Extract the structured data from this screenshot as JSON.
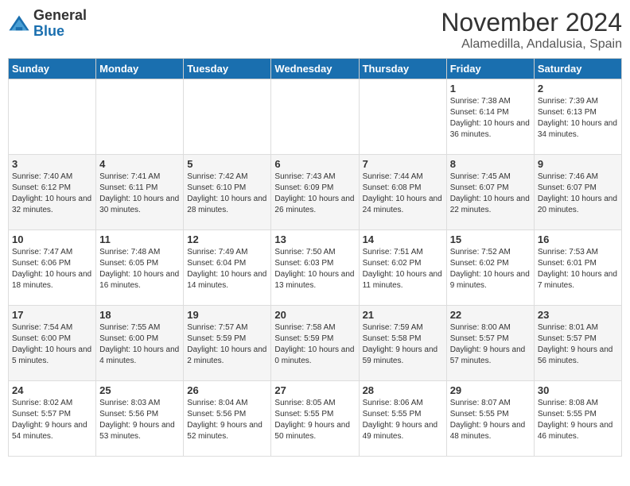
{
  "header": {
    "logo_general": "General",
    "logo_blue": "Blue",
    "month_title": "November 2024",
    "location": "Alamedilla, Andalusia, Spain"
  },
  "weekdays": [
    "Sunday",
    "Monday",
    "Tuesday",
    "Wednesday",
    "Thursday",
    "Friday",
    "Saturday"
  ],
  "weeks": [
    [
      {
        "day": "",
        "info": ""
      },
      {
        "day": "",
        "info": ""
      },
      {
        "day": "",
        "info": ""
      },
      {
        "day": "",
        "info": ""
      },
      {
        "day": "",
        "info": ""
      },
      {
        "day": "1",
        "info": "Sunrise: 7:38 AM\nSunset: 6:14 PM\nDaylight: 10 hours and 36 minutes."
      },
      {
        "day": "2",
        "info": "Sunrise: 7:39 AM\nSunset: 6:13 PM\nDaylight: 10 hours and 34 minutes."
      }
    ],
    [
      {
        "day": "3",
        "info": "Sunrise: 7:40 AM\nSunset: 6:12 PM\nDaylight: 10 hours and 32 minutes."
      },
      {
        "day": "4",
        "info": "Sunrise: 7:41 AM\nSunset: 6:11 PM\nDaylight: 10 hours and 30 minutes."
      },
      {
        "day": "5",
        "info": "Sunrise: 7:42 AM\nSunset: 6:10 PM\nDaylight: 10 hours and 28 minutes."
      },
      {
        "day": "6",
        "info": "Sunrise: 7:43 AM\nSunset: 6:09 PM\nDaylight: 10 hours and 26 minutes."
      },
      {
        "day": "7",
        "info": "Sunrise: 7:44 AM\nSunset: 6:08 PM\nDaylight: 10 hours and 24 minutes."
      },
      {
        "day": "8",
        "info": "Sunrise: 7:45 AM\nSunset: 6:07 PM\nDaylight: 10 hours and 22 minutes."
      },
      {
        "day": "9",
        "info": "Sunrise: 7:46 AM\nSunset: 6:07 PM\nDaylight: 10 hours and 20 minutes."
      }
    ],
    [
      {
        "day": "10",
        "info": "Sunrise: 7:47 AM\nSunset: 6:06 PM\nDaylight: 10 hours and 18 minutes."
      },
      {
        "day": "11",
        "info": "Sunrise: 7:48 AM\nSunset: 6:05 PM\nDaylight: 10 hours and 16 minutes."
      },
      {
        "day": "12",
        "info": "Sunrise: 7:49 AM\nSunset: 6:04 PM\nDaylight: 10 hours and 14 minutes."
      },
      {
        "day": "13",
        "info": "Sunrise: 7:50 AM\nSunset: 6:03 PM\nDaylight: 10 hours and 13 minutes."
      },
      {
        "day": "14",
        "info": "Sunrise: 7:51 AM\nSunset: 6:02 PM\nDaylight: 10 hours and 11 minutes."
      },
      {
        "day": "15",
        "info": "Sunrise: 7:52 AM\nSunset: 6:02 PM\nDaylight: 10 hours and 9 minutes."
      },
      {
        "day": "16",
        "info": "Sunrise: 7:53 AM\nSunset: 6:01 PM\nDaylight: 10 hours and 7 minutes."
      }
    ],
    [
      {
        "day": "17",
        "info": "Sunrise: 7:54 AM\nSunset: 6:00 PM\nDaylight: 10 hours and 5 minutes."
      },
      {
        "day": "18",
        "info": "Sunrise: 7:55 AM\nSunset: 6:00 PM\nDaylight: 10 hours and 4 minutes."
      },
      {
        "day": "19",
        "info": "Sunrise: 7:57 AM\nSunset: 5:59 PM\nDaylight: 10 hours and 2 minutes."
      },
      {
        "day": "20",
        "info": "Sunrise: 7:58 AM\nSunset: 5:59 PM\nDaylight: 10 hours and 0 minutes."
      },
      {
        "day": "21",
        "info": "Sunrise: 7:59 AM\nSunset: 5:58 PM\nDaylight: 9 hours and 59 minutes."
      },
      {
        "day": "22",
        "info": "Sunrise: 8:00 AM\nSunset: 5:57 PM\nDaylight: 9 hours and 57 minutes."
      },
      {
        "day": "23",
        "info": "Sunrise: 8:01 AM\nSunset: 5:57 PM\nDaylight: 9 hours and 56 minutes."
      }
    ],
    [
      {
        "day": "24",
        "info": "Sunrise: 8:02 AM\nSunset: 5:57 PM\nDaylight: 9 hours and 54 minutes."
      },
      {
        "day": "25",
        "info": "Sunrise: 8:03 AM\nSunset: 5:56 PM\nDaylight: 9 hours and 53 minutes."
      },
      {
        "day": "26",
        "info": "Sunrise: 8:04 AM\nSunset: 5:56 PM\nDaylight: 9 hours and 52 minutes."
      },
      {
        "day": "27",
        "info": "Sunrise: 8:05 AM\nSunset: 5:55 PM\nDaylight: 9 hours and 50 minutes."
      },
      {
        "day": "28",
        "info": "Sunrise: 8:06 AM\nSunset: 5:55 PM\nDaylight: 9 hours and 49 minutes."
      },
      {
        "day": "29",
        "info": "Sunrise: 8:07 AM\nSunset: 5:55 PM\nDaylight: 9 hours and 48 minutes."
      },
      {
        "day": "30",
        "info": "Sunrise: 8:08 AM\nSunset: 5:55 PM\nDaylight: 9 hours and 46 minutes."
      }
    ]
  ]
}
